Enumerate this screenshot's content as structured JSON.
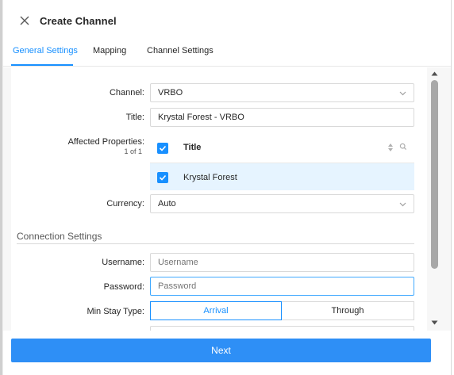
{
  "header": {
    "title": "Create Channel",
    "close_icon": "close-icon"
  },
  "tabs": [
    {
      "label": "General Settings",
      "active": true
    },
    {
      "label": "Mapping",
      "active": false
    },
    {
      "label": "Channel Settings",
      "active": false
    }
  ],
  "form": {
    "channel": {
      "label": "Channel:",
      "value": "VRBO"
    },
    "title": {
      "label": "Title:",
      "value": "Krystal Forest - VRBO"
    },
    "affected": {
      "label": "Affected Properties:",
      "count": "1 of 1",
      "column_header": "Title",
      "rows": [
        {
          "name": "Krystal Forest",
          "checked": true
        }
      ],
      "header_checked": true
    },
    "currency": {
      "label": "Currency:",
      "value": "Auto"
    }
  },
  "connection": {
    "section_title": "Connection Settings",
    "username": {
      "label": "Username:",
      "placeholder": "Username",
      "value": ""
    },
    "password": {
      "label": "Password:",
      "placeholder": "Password",
      "value": ""
    },
    "min_stay": {
      "label": "Min Stay Type:",
      "options": [
        "Arrival",
        "Through"
      ],
      "selected": "Arrival"
    }
  },
  "footer": {
    "next_label": "Next"
  },
  "colors": {
    "accent": "#1890ff",
    "button": "#2e8ff6",
    "row_highlight": "#e6f4ff"
  }
}
